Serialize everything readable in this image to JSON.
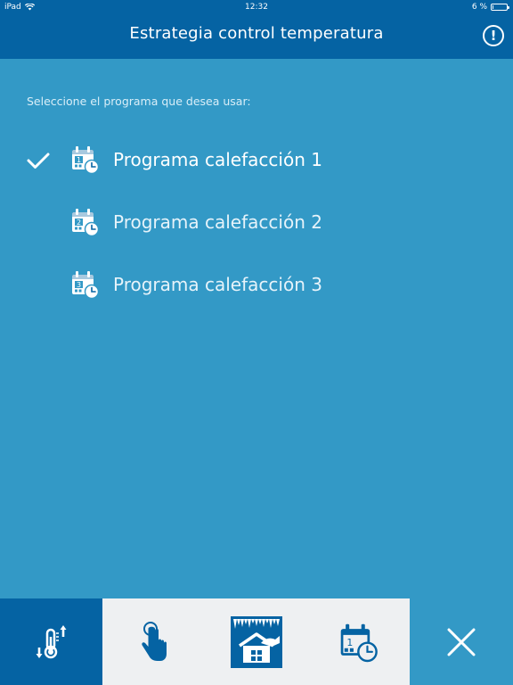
{
  "status_bar": {
    "device": "iPad",
    "time": "12:32",
    "battery": "6 %",
    "battery_level": 0.06,
    "wifi_icon": "wifi-icon",
    "battery_icon": "battery-icon"
  },
  "nav": {
    "title": "Estrategia control temperatura",
    "info_icon": "info-icon",
    "info_glyph": "!"
  },
  "content": {
    "prompt": "Seleccione el programa que desea usar:",
    "programs": [
      {
        "label": "Programa calefacción 1",
        "number": "1",
        "selected": true,
        "icon": "calendar-clock-icon"
      },
      {
        "label": "Programa calefacción 2",
        "number": "2",
        "selected": false,
        "icon": "calendar-clock-icon"
      },
      {
        "label": "Programa calefacción 3",
        "number": "3",
        "selected": false,
        "icon": "calendar-clock-icon"
      }
    ],
    "check_icon": "checkmark-icon"
  },
  "toolbar": {
    "items": [
      {
        "icon": "thermometer-arrows-icon",
        "active": true
      },
      {
        "icon": "touch-hand-icon",
        "active": false
      },
      {
        "icon": "house-protection-icon",
        "active": false
      },
      {
        "icon": "calendar-clock-icon",
        "number": "1",
        "active": false
      },
      {
        "icon": "close-icon",
        "active": false
      }
    ]
  },
  "colors": {
    "header_bg": "#0563a3",
    "content_bg": "#3399c6",
    "toolbar_light_bg": "#eef0f2",
    "icon_dark": "#0563a3",
    "text_white": "#ffffff"
  }
}
